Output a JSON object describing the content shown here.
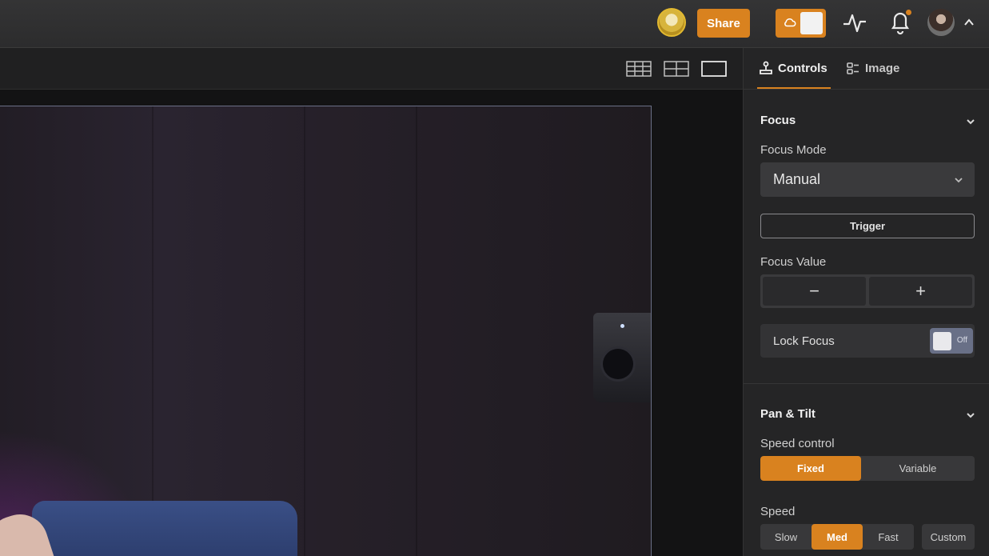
{
  "topbar": {
    "share_label": "Share",
    "accent_color": "#d9821f",
    "icons": [
      "user-avatar",
      "cloud-icon",
      "activity-icon",
      "bell-icon",
      "user-avatar",
      "chevron-up-icon"
    ]
  },
  "viewbar": {
    "layouts": [
      "grid-3x3-icon",
      "grid-2x2-icon",
      "single-view-icon"
    ]
  },
  "panel": {
    "tabs": [
      {
        "label": "Controls",
        "icon": "joystick-icon",
        "active": true
      },
      {
        "label": "Image",
        "icon": "image-settings-icon",
        "active": false
      }
    ],
    "focus": {
      "title": "Focus",
      "mode_label": "Focus Mode",
      "mode_value": "Manual",
      "trigger_label": "Trigger",
      "value_label": "Focus Value",
      "minus": "−",
      "plus": "+",
      "lock_label": "Lock Focus",
      "lock_state": "Off"
    },
    "pan_tilt": {
      "title": "Pan & Tilt",
      "speed_control_label": "Speed control",
      "speed_control_options": [
        "Fixed",
        "Variable"
      ],
      "speed_control_selected": "Fixed",
      "speed_label": "Speed",
      "speed_options": [
        "Slow",
        "Med",
        "Fast"
      ],
      "speed_selected": "Med",
      "custom_label": "Custom"
    }
  }
}
